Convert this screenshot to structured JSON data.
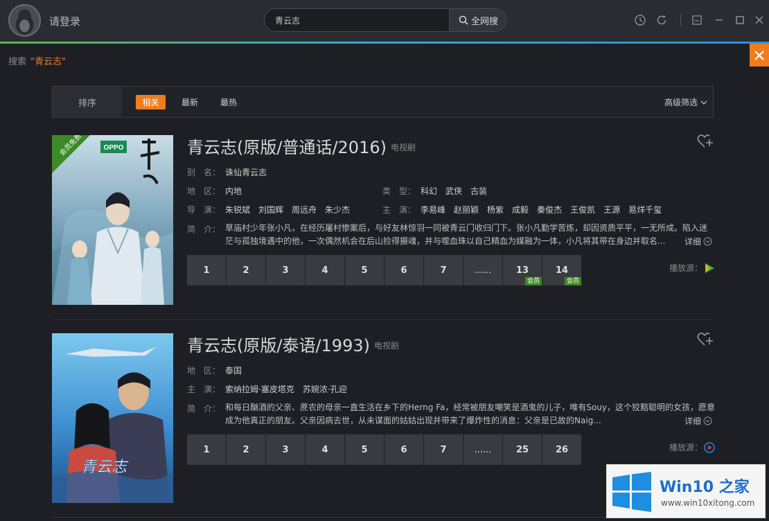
{
  "header": {
    "login_label": "请登录",
    "search_value": "青云志",
    "search_button_label": "全网搜"
  },
  "crumb": {
    "prefix": "搜索",
    "query_quoted": "\"青云志\""
  },
  "sortbar": {
    "label": "排序",
    "options": [
      "相关",
      "最新",
      "最热"
    ],
    "active_option": "相关",
    "advanced_label": "高级筛选"
  },
  "results": [
    {
      "title": "青云志(原版/普通话/2016)",
      "type_tag": "电视剧",
      "poster_badge": "会员免费",
      "poster_brand": "OPPO",
      "fields": {
        "alias_label": "别　名：",
        "alias": "诛仙青云志",
        "region_label": "地　区：",
        "region": "内地",
        "genre_label": "类　型：",
        "genres": [
          "科幻",
          "武侠",
          "古装"
        ],
        "director_label": "导　演：",
        "directors": [
          "朱锐斌",
          "刘国辉",
          "周远舟",
          "朱少杰"
        ],
        "cast_label": "主　演：",
        "cast": [
          "李易峰",
          "赵丽颖",
          "杨紫",
          "成毅",
          "秦俊杰",
          "王俊凯",
          "王源",
          "易烊千玺"
        ],
        "intro_label": "简　介：",
        "intro_line1": "草庙村少年张小凡，在经历屠村惨案后，与好友林惊羽一同被青云门收归门下。张小凡勤学苦炼，却因资质平平，一无所成。陷入迷",
        "intro_line2": "茫与孤独境遇中的他，一次偶然机会在后山捡得摄魂，并与噬血珠以自己精血为媒融为一体，小凡将其带在身边并取名..."
      },
      "detail_label": "详细",
      "episodes": [
        {
          "label": "1"
        },
        {
          "label": "2"
        },
        {
          "label": "3"
        },
        {
          "label": "4"
        },
        {
          "label": "5"
        },
        {
          "label": "6"
        },
        {
          "label": "7"
        },
        {
          "label": "......"
        },
        {
          "label": "13",
          "badge": "会员"
        },
        {
          "label": "14",
          "badge": "会员"
        }
      ],
      "play_source_label": "播放源：",
      "source_color": "#2ab34a"
    },
    {
      "title": "青云志(原版/泰语/1993)",
      "type_tag": "电视剧",
      "poster_text": "青云志",
      "fields": {
        "region_label": "地　区：",
        "region": "泰国",
        "cast_label": "主　演：",
        "cast": [
          "索纳拉姆·塞皮塔克",
          "苏婉浓·孔迎"
        ],
        "intro_label": "简　介：",
        "intro_line1": "和每日酗酒的父亲、蔗农的母亲一直生活在乡下的Herng Fa，经常被朋友嘲笑是酒鬼的儿子，唯有Souy，这个狡黠聪明的女孩，愿意",
        "intro_line2": "成为他真正的朋友。父亲因病去世，从未谋面的姑姑出现并带来了爆炸性的消息：父亲是已故的Naig..."
      },
      "detail_label": "详细",
      "episodes": [
        {
          "label": "1"
        },
        {
          "label": "2"
        },
        {
          "label": "3"
        },
        {
          "label": "4"
        },
        {
          "label": "5"
        },
        {
          "label": "6"
        },
        {
          "label": "7"
        },
        {
          "label": "......"
        },
        {
          "label": "25"
        },
        {
          "label": "26"
        }
      ],
      "play_source_label": "播放源：",
      "source_color": "#1e88e5"
    }
  ],
  "watermark": {
    "name": "Win10 之家",
    "url": "www.win10xitong.com"
  },
  "colors": {
    "accent": "#f07c1e",
    "background": "#1e1f24",
    "topbar": "#2b2c31",
    "vip_green": "#3b8a25"
  }
}
